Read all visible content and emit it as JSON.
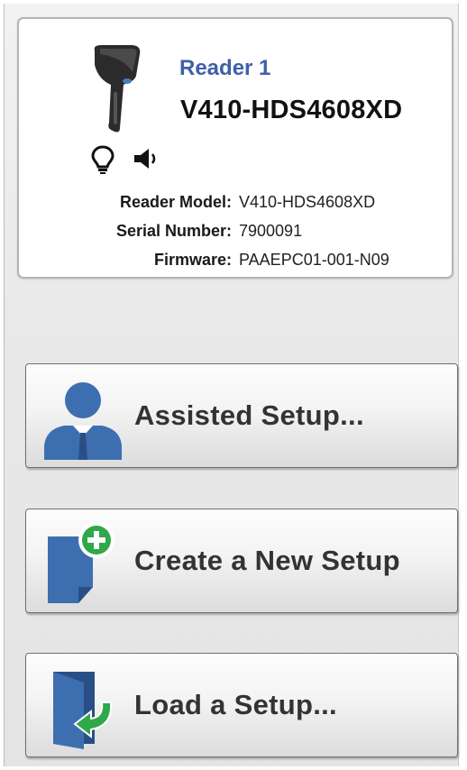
{
  "reader": {
    "name": "Reader 1",
    "model_title": "V410-HDS4608XD",
    "details": [
      {
        "label": "Reader Model:",
        "value": "V410-HDS4608XD"
      },
      {
        "label": "Serial Number:",
        "value": "7900091"
      },
      {
        "label": "Firmware:",
        "value": "PAAEPC01-001-N09"
      }
    ]
  },
  "actions": [
    {
      "label": "Assisted Setup...",
      "icon": "user-icon"
    },
    {
      "label": "Create a New Setup",
      "icon": "new-document-icon"
    },
    {
      "label": "Load a Setup...",
      "icon": "open-door-icon"
    }
  ],
  "colors": {
    "reader_name": "#3f60a8",
    "icon_blue": "#3d6fb0",
    "icon_green": "#2fa84a"
  }
}
